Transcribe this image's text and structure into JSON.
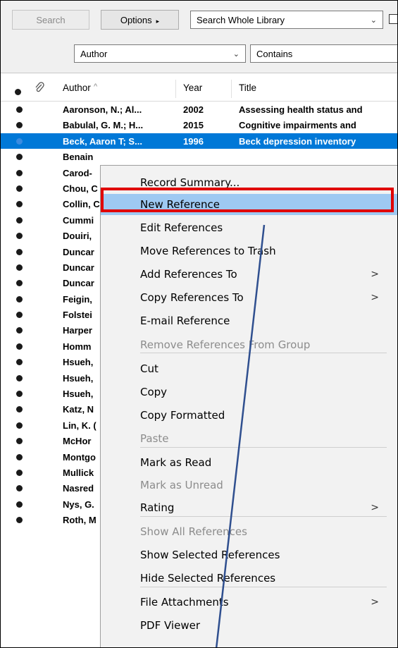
{
  "toolbar": {
    "search_label": "Search",
    "options_label": "Options",
    "options_arrow": "▸",
    "library_scope": "Search Whole Library",
    "field": "Author",
    "operator": "Contains"
  },
  "table": {
    "headers": {
      "author": "Author",
      "year": "Year",
      "title": "Title"
    },
    "rows": [
      {
        "author": "Aaronson, N.; Al...",
        "year": "2002",
        "title": "Assessing health status and"
      },
      {
        "author": "Babulal, G. M.; H...",
        "year": "2015",
        "title": "Cognitive impairments and"
      },
      {
        "author": "Beck, Aaron T; S...",
        "year": "1996",
        "title": "Beck depression inventory"
      },
      {
        "author": "Benain",
        "year": "",
        "title": ""
      },
      {
        "author": "Carod-",
        "year": "",
        "title": ""
      },
      {
        "author": "Chou, C",
        "year": "",
        "title": ""
      },
      {
        "author": "Collin, C",
        "year": "",
        "title": ""
      },
      {
        "author": "Cummi",
        "year": "",
        "title": ""
      },
      {
        "author": "Douiri,",
        "year": "",
        "title": ""
      },
      {
        "author": "Duncar",
        "year": "",
        "title": ""
      },
      {
        "author": "Duncar",
        "year": "",
        "title": ""
      },
      {
        "author": "Duncar",
        "year": "",
        "title": ""
      },
      {
        "author": "Feigin,",
        "year": "",
        "title": ""
      },
      {
        "author": "Folstei",
        "year": "",
        "title": ""
      },
      {
        "author": "Harper",
        "year": "",
        "title": ""
      },
      {
        "author": "Homm",
        "year": "",
        "title": ""
      },
      {
        "author": "Hsueh,",
        "year": "",
        "title": ""
      },
      {
        "author": "Hsueh,",
        "year": "",
        "title": ""
      },
      {
        "author": "Hsueh,",
        "year": "",
        "title": ""
      },
      {
        "author": "Katz, N",
        "year": "",
        "title": ""
      },
      {
        "author": "Lin, K. (",
        "year": "",
        "title": ""
      },
      {
        "author": "McHor",
        "year": "",
        "title": ""
      },
      {
        "author": "Montgo",
        "year": "",
        "title": ""
      },
      {
        "author": "Mullick",
        "year": "",
        "title": ""
      },
      {
        "author": "Nasred",
        "year": "",
        "title": ""
      },
      {
        "author": "Nys, G.",
        "year": "",
        "title": ""
      },
      {
        "author": "Roth, M",
        "year": "",
        "title": ""
      }
    ]
  },
  "context_menu": {
    "items": [
      {
        "label": "Record Summary...",
        "disabled": false
      },
      {
        "label": "New Reference",
        "disabled": false
      },
      {
        "label": "Edit References",
        "disabled": false
      },
      {
        "label": "Move References to Trash",
        "disabled": false
      },
      {
        "label": "Add References To",
        "disabled": false,
        "submenu": ">"
      },
      {
        "label": "Copy References To",
        "disabled": false,
        "submenu": ">"
      },
      {
        "label": "E-mail Reference",
        "disabled": false
      },
      {
        "label": "Remove References From Group",
        "disabled": true
      },
      {
        "label": "Cut",
        "disabled": false
      },
      {
        "label": "Copy",
        "disabled": false
      },
      {
        "label": "Copy Formatted",
        "disabled": false
      },
      {
        "label": "Paste",
        "disabled": true
      },
      {
        "label": "Mark as Read",
        "disabled": false
      },
      {
        "label": "Mark as Unread",
        "disabled": true
      },
      {
        "label": "Rating",
        "disabled": false,
        "submenu": ">"
      },
      {
        "label": "Show All References",
        "disabled": true
      },
      {
        "label": "Show Selected References",
        "disabled": false
      },
      {
        "label": "Hide Selected References",
        "disabled": false
      },
      {
        "label": "File Attachments",
        "disabled": false,
        "submenu": ">"
      },
      {
        "label": "PDF Viewer",
        "disabled": false
      }
    ]
  },
  "colors": {
    "selection": "#0078d7",
    "menu_highlight": "#9ec9f2",
    "annotation_box": "#e00000",
    "annotation_arrow": "#2f4f8f"
  }
}
